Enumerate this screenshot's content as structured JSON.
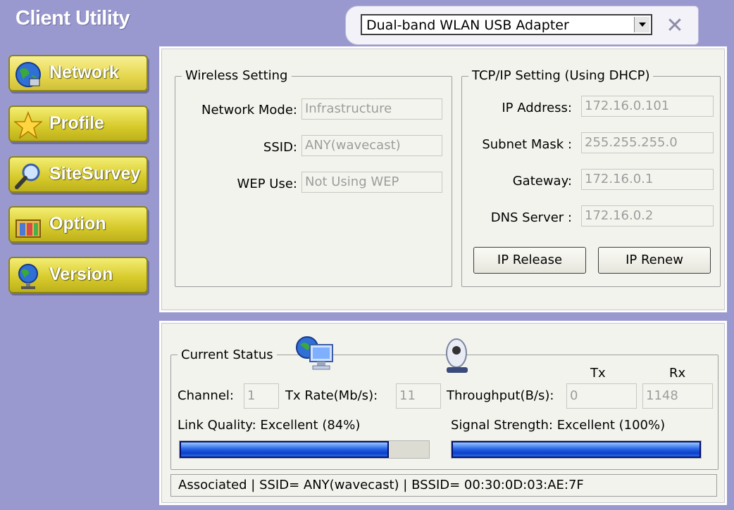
{
  "app": {
    "title": "Client Utility"
  },
  "adapter": {
    "selected": "Dual-band WLAN USB Adapter"
  },
  "nav": [
    {
      "label": "Network",
      "icon": "globe-network-icon"
    },
    {
      "label": "Profile",
      "icon": "star-icon"
    },
    {
      "label": "SiteSurvey",
      "icon": "magnifier-icon"
    },
    {
      "label": "Option",
      "icon": "toolbox-icon"
    },
    {
      "label": "Version",
      "icon": "globe-stand-icon"
    }
  ],
  "wireless": {
    "title": "Wireless Setting",
    "network_mode_label": "Network Mode:",
    "network_mode_value": "Infrastructure",
    "ssid_label": "SSID:",
    "ssid_value": "ANY(wavecast)",
    "wep_label": "WEP Use:",
    "wep_value": "Not Using WEP"
  },
  "tcpip": {
    "title": "TCP/IP Setting",
    "subtitle": "(Using DHCP)",
    "ip_label": "IP Address:",
    "ip_value": "172.16.0.101",
    "mask_label": "Subnet Mask :",
    "mask_value": "255.255.255.0",
    "gateway_label": "Gateway:",
    "gateway_value": "172.16.0.1",
    "dns_label": "DNS Server :",
    "dns_value": "172.16.0.2",
    "release_label": "IP Release",
    "renew_label": "IP Renew"
  },
  "status": {
    "title": "Current Status",
    "channel_label": "Channel:",
    "channel_value": "1",
    "txrate_label": "Tx Rate(Mb/s):",
    "txrate_value": "11",
    "throughput_label": "Throughput(B/s):",
    "tx_header": "Tx",
    "rx_header": "Rx",
    "tx_value": "0",
    "rx_value": "1148",
    "link_label": "Link Quality:",
    "link_value": "Excellent (84%)",
    "link_percent": 84,
    "signal_label": "Signal Strength:",
    "signal_value": "Excellent (100%)",
    "signal_percent": 100,
    "statusline": "Associated | SSID= ANY(wavecast) | BSSID= 00:30:0D:03:AE:7F"
  },
  "colors": {
    "background": "#9a99cf",
    "nav_button": "#d6c92a",
    "bar": "#2a66e6"
  }
}
